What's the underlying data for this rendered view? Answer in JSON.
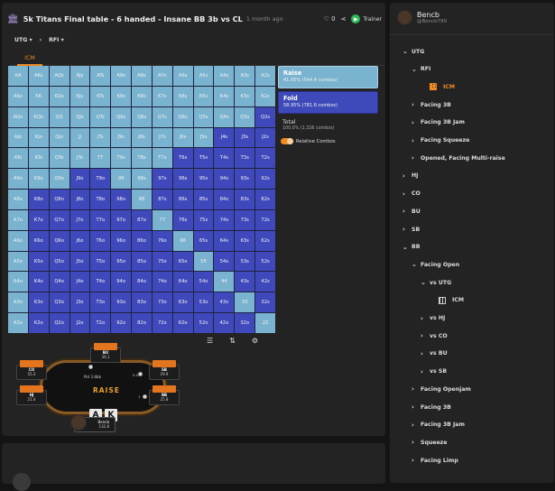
{
  "header": {
    "title": "5k Titans Final table - 6 handed - Insane BB 3b vs CL",
    "time": "1 month ago",
    "likes": "0",
    "trainer_label": "Trainer",
    "trainer_icon": "play-icon"
  },
  "breadcrumb": {
    "first": "UTG",
    "second": "RFI"
  },
  "tabs": {
    "active": "ICM"
  },
  "legend": {
    "raise_label": "Raise",
    "raise_stats": "41.05% (544.4 combos)",
    "fold_label": "Fold",
    "fold_stats": "58.95% (781.6 combos)",
    "total_label": "Total",
    "total_stats": "100.0% (1,326 combos)",
    "relative_label": "Relative Combos"
  },
  "colors": {
    "raise": "#7ab3cf",
    "fold": "#4049bb",
    "accent": "#f08a24"
  },
  "range": {
    "labels": [
      [
        "AA",
        "AKs",
        "AQs",
        "AJs",
        "ATs",
        "A9s",
        "A8s",
        "A7s",
        "A6s",
        "A5s",
        "A4s",
        "A3s",
        "A2s"
      ],
      [
        "AKo",
        "KK",
        "KQs",
        "KJs",
        "KTs",
        "K9s",
        "K8s",
        "K7s",
        "K6s",
        "K5s",
        "K4s",
        "K3s",
        "K2s"
      ],
      [
        "AQo",
        "KQo",
        "QQ",
        "QJs",
        "QTs",
        "Q9s",
        "Q8s",
        "Q7s",
        "Q6s",
        "Q5s",
        "Q4s",
        "Q3s",
        "Q2s"
      ],
      [
        "AJo",
        "KJo",
        "QJo",
        "JJ",
        "JTs",
        "J9s",
        "J8s",
        "J7s",
        "J6s",
        "J5s",
        "J4s",
        "J3s",
        "J2s"
      ],
      [
        "ATo",
        "KTo",
        "QTo",
        "JTo",
        "TT",
        "T9s",
        "T8s",
        "T7s",
        "T6s",
        "T5s",
        "T4s",
        "T3s",
        "T2s"
      ],
      [
        "A9o",
        "K9o",
        "Q9o",
        "J9o",
        "T9o",
        "99",
        "98s",
        "97s",
        "96s",
        "95s",
        "94s",
        "93s",
        "92s"
      ],
      [
        "A8o",
        "K8o",
        "Q8o",
        "J8o",
        "T8o",
        "98o",
        "88",
        "87s",
        "86s",
        "85s",
        "84s",
        "83s",
        "82s"
      ],
      [
        "A7o",
        "K7o",
        "Q7o",
        "J7o",
        "T7o",
        "97o",
        "87o",
        "77",
        "76s",
        "75s",
        "74s",
        "73s",
        "72s"
      ],
      [
        "A6o",
        "K6o",
        "Q6o",
        "J6o",
        "T6o",
        "96o",
        "86o",
        "76o",
        "66",
        "65s",
        "64s",
        "63s",
        "62s"
      ],
      [
        "A5o",
        "K5o",
        "Q5o",
        "J5o",
        "T5o",
        "95o",
        "85o",
        "75o",
        "65o",
        "55",
        "54s",
        "53s",
        "52s"
      ],
      [
        "A4o",
        "K4o",
        "Q4o",
        "J4o",
        "T4o",
        "94o",
        "84o",
        "74o",
        "64o",
        "54o",
        "44",
        "43s",
        "42s"
      ],
      [
        "A3o",
        "K3o",
        "Q3o",
        "J3o",
        "T3o",
        "93o",
        "83o",
        "73o",
        "63o",
        "53o",
        "43o",
        "33",
        "32s"
      ],
      [
        "A2o",
        "K2o",
        "Q2o",
        "J2o",
        "T2o",
        "92o",
        "82o",
        "72o",
        "62o",
        "52o",
        "42o",
        "32o",
        "22"
      ]
    ],
    "raise": [
      [
        1,
        1,
        1,
        1,
        1,
        1,
        1,
        1,
        1,
        1,
        1,
        1,
        1
      ],
      [
        1,
        1,
        1,
        1,
        1,
        1,
        1,
        1,
        1,
        1,
        1,
        1,
        1
      ],
      [
        1,
        1,
        1,
        1,
        1,
        1,
        1,
        1,
        1,
        1,
        1,
        1,
        0
      ],
      [
        1,
        1,
        1,
        1,
        1,
        1,
        1,
        1,
        1,
        1,
        0,
        0,
        0
      ],
      [
        1,
        1,
        1,
        1,
        1,
        1,
        1,
        1,
        0,
        0,
        0,
        0,
        0
      ],
      [
        1,
        1,
        1,
        0,
        0,
        1,
        1,
        0,
        0,
        0,
        0,
        0,
        0
      ],
      [
        1,
        0,
        0,
        0,
        0,
        0,
        1,
        0,
        0,
        0,
        0,
        0,
        0
      ],
      [
        1,
        0,
        0,
        0,
        0,
        0,
        0,
        1,
        0,
        0,
        0,
        0,
        0
      ],
      [
        1,
        0,
        0,
        0,
        0,
        0,
        0,
        0,
        1,
        0,
        0,
        0,
        0
      ],
      [
        1,
        0,
        0,
        0,
        0,
        0,
        0,
        0,
        0,
        1,
        0,
        0,
        0
      ],
      [
        1,
        0,
        0,
        0,
        0,
        0,
        0,
        0,
        0,
        0,
        1,
        0,
        0
      ],
      [
        1,
        0,
        0,
        0,
        0,
        0,
        0,
        0,
        0,
        0,
        0,
        1,
        0
      ],
      [
        1,
        0,
        0,
        0,
        0,
        0,
        0,
        0,
        0,
        0,
        0,
        0,
        1
      ]
    ]
  },
  "tools": {
    "list_icon": "list-icon",
    "sort_icon": "sort-icon",
    "settings_icon": "chip-settings-icon"
  },
  "poker_table": {
    "logo": "RAISE",
    "pot_label": "Pot 3.8bb",
    "seats": [
      {
        "pos": "BU",
        "stack": "36.1"
      },
      {
        "pos": "CO",
        "stack": "55.3"
      },
      {
        "pos": "SB",
        "stack": "29.9"
      },
      {
        "pos": "HJ",
        "stack": "21.4"
      },
      {
        "pos": "BB",
        "stack": "25.8"
      }
    ],
    "hero": {
      "name": "Bencb",
      "stack": "132.8",
      "cards": [
        "A",
        "K"
      ]
    },
    "blind_sb": "0.5",
    "blind_bb": "1"
  },
  "user": {
    "name": "Bencb",
    "handle": "@Bencb789"
  },
  "tree": [
    {
      "label": "UTG",
      "depth": 0,
      "chev": "⌄"
    },
    {
      "label": "RFI",
      "depth": 1,
      "chev": "⌄"
    },
    {
      "label": "ICM",
      "depth": 2,
      "chev": "",
      "icon": "orange",
      "selected": true
    },
    {
      "label": "Facing 3B",
      "depth": 1,
      "chev": "›"
    },
    {
      "label": "Facing 3B Jam",
      "depth": 1,
      "chev": "›"
    },
    {
      "label": "Facing Squeeze",
      "depth": 1,
      "chev": "›"
    },
    {
      "label": "Opened, Facing Multi-raise",
      "depth": 1,
      "chev": "›"
    },
    {
      "label": "HJ",
      "depth": 0,
      "chev": "›"
    },
    {
      "label": "CO",
      "depth": 0,
      "chev": "›"
    },
    {
      "label": "BU",
      "depth": 0,
      "chev": "›"
    },
    {
      "label": "SB",
      "depth": 0,
      "chev": "›"
    },
    {
      "label": "BB",
      "depth": 0,
      "chev": "⌄"
    },
    {
      "label": "Facing Open",
      "depth": 1,
      "chev": "⌄"
    },
    {
      "label": "vs UTG",
      "depth": 2,
      "chev": "⌄"
    },
    {
      "label": "ICM",
      "depth": 3,
      "chev": "",
      "icon": "white"
    },
    {
      "label": "vs HJ",
      "depth": 2,
      "chev": "›"
    },
    {
      "label": "vs CO",
      "depth": 2,
      "chev": "›"
    },
    {
      "label": "vs BU",
      "depth": 2,
      "chev": "›"
    },
    {
      "label": "vs SB",
      "depth": 2,
      "chev": "›"
    },
    {
      "label": "Facing Openjam",
      "depth": 1,
      "chev": "›"
    },
    {
      "label": "Facing 3B",
      "depth": 1,
      "chev": "›"
    },
    {
      "label": "Facing 3B Jam",
      "depth": 1,
      "chev": "›"
    },
    {
      "label": "Squeeze",
      "depth": 1,
      "chev": "›"
    },
    {
      "label": "Facing Limp",
      "depth": 1,
      "chev": "›"
    }
  ]
}
